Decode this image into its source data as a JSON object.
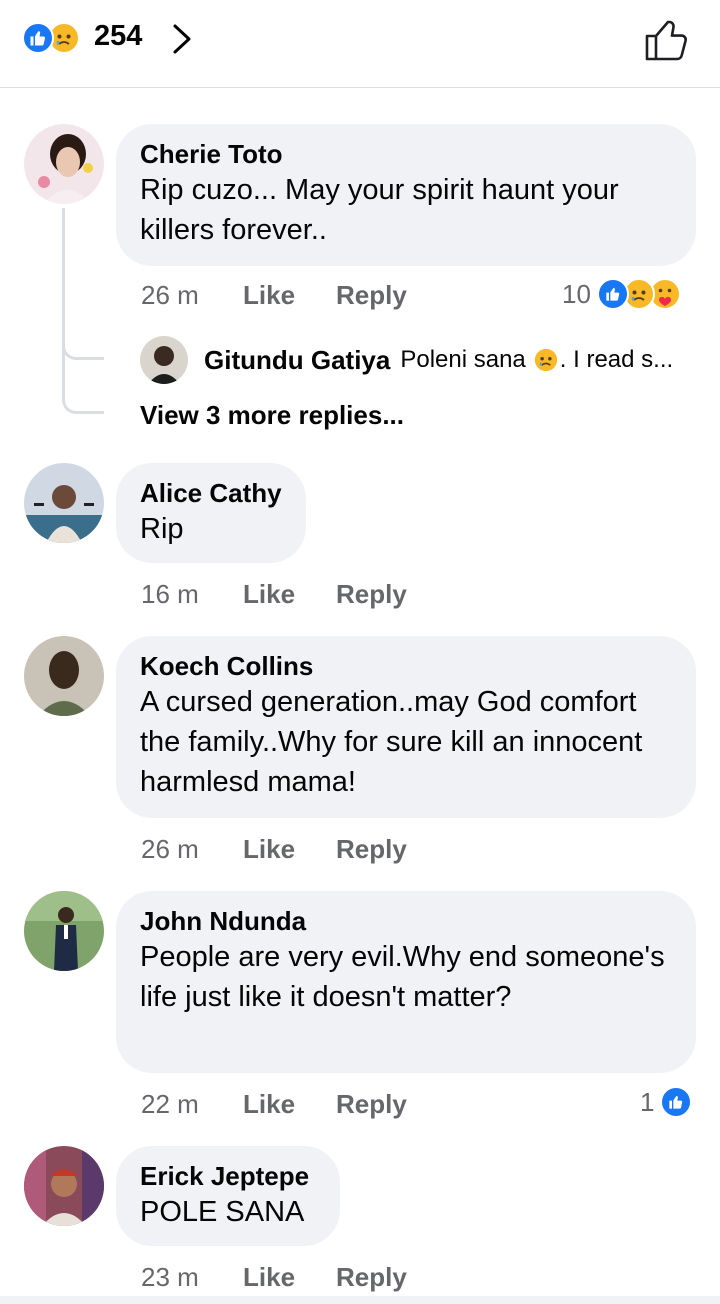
{
  "header": {
    "reaction_count": "254",
    "icons": [
      "like-icon",
      "sad-icon",
      "chevron-right-icon",
      "thumbs-up-outline-icon"
    ]
  },
  "colors": {
    "like_blue": "#1877f2",
    "bubble_bg": "#f0f2f5",
    "meta_gray": "#65676b",
    "emoji_yellow": "#f7b928"
  },
  "comments": [
    {
      "name": "Cherie Toto",
      "text": "Rip cuzo... May your spirit haunt your killers forever..",
      "time": "26 m",
      "like_label": "Like",
      "reply_label": "Reply",
      "reaction_count": "10",
      "reactions": [
        "like-icon",
        "sad-icon",
        "care-icon"
      ],
      "reply_preview": {
        "name": "Gitundu Gatiya",
        "text_before": "Poleni sana",
        "text_after": ". I read s..."
      },
      "view_more": "View 3 more replies..."
    },
    {
      "name": "Alice Cathy",
      "text": "Rip",
      "time": "16 m",
      "like_label": "Like",
      "reply_label": "Reply"
    },
    {
      "name": "Koech Collins",
      "text": "A cursed generation..may God comfort the family..Why for sure kill an innocent harmlesd mama!",
      "time": "26 m",
      "like_label": "Like",
      "reply_label": "Reply"
    },
    {
      "name": "John Ndunda",
      "text": "People are very evil.Why end someone's life just like it doesn't matter?",
      "time": "22 m",
      "like_label": "Like",
      "reply_label": "Reply",
      "reaction_count": "1",
      "reactions": [
        "like-icon"
      ]
    },
    {
      "name": "Erick Jeptepe",
      "text": "POLE SANA",
      "time": "23 m",
      "like_label": "Like",
      "reply_label": "Reply"
    }
  ]
}
